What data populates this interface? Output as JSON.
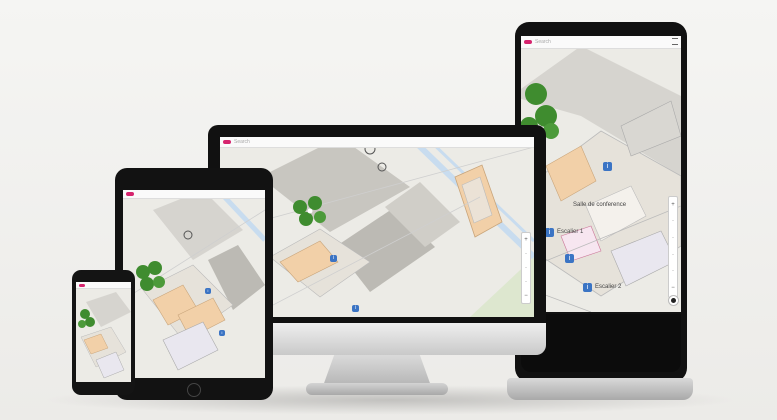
{
  "map_ui": {
    "search_placeholder": "Search",
    "zoom_controls": [
      "+",
      "−"
    ],
    "tower_labels": {
      "salle": "Salle de conference",
      "poi_a": "Escalier 1",
      "poi_b": "Escalier 2"
    }
  },
  "colors": {
    "brand": "#d6246e",
    "map_bg": "#ecebe6",
    "building": "#c8c6c0",
    "room_orange": "#f2d0a8",
    "water": "#c8dcef",
    "park": "#dde7cf",
    "tree": "#3f8c2f",
    "poi_blue": "#3b74c4"
  },
  "devices": [
    "smartphone",
    "tablet",
    "desktop-monitor",
    "kiosk-totem"
  ]
}
